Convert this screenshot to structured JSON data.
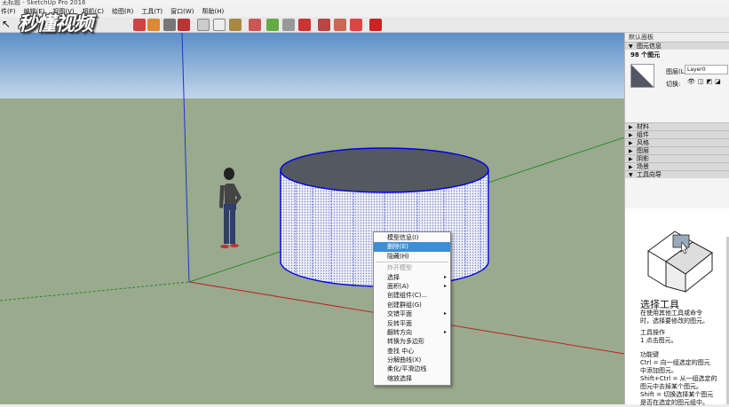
{
  "window": {
    "title": "无标题 - SketchUp Pro 2016"
  },
  "menu": [
    "件(F)",
    "编辑(E)",
    "视图(V)",
    "相机(C)",
    "绘图(R)",
    "工具(T)",
    "窗口(W)",
    "帮助(H)"
  ],
  "watermark": "秒懂视频",
  "context_menu": {
    "items": [
      {
        "label": "模型信息(I)",
        "state": "normal"
      },
      {
        "label": "删除(E)",
        "state": "highlight"
      },
      {
        "label": "隐藏(H)",
        "state": "normal"
      },
      {
        "label": "炸开模型",
        "state": "disabled"
      },
      {
        "label": "选择",
        "state": "submenu"
      },
      {
        "label": "面积(A)",
        "state": "submenu"
      },
      {
        "label": "创建组件(C)...",
        "state": "normal"
      },
      {
        "label": "创建群组(G)",
        "state": "normal"
      },
      {
        "label": "交错平面",
        "state": "submenu"
      },
      {
        "label": "反转平面",
        "state": "normal"
      },
      {
        "label": "翻转方向",
        "state": "submenu"
      },
      {
        "label": "转换为多边形",
        "state": "normal"
      },
      {
        "label": "查找 中心",
        "state": "normal"
      },
      {
        "label": "分解曲线(X)",
        "state": "normal"
      },
      {
        "label": "柔化/平滑边线",
        "state": "normal"
      },
      {
        "label": "缩放选择",
        "state": "normal"
      }
    ]
  },
  "panel": {
    "title": "默认面板",
    "entity_info": {
      "header": "图元信息",
      "count": "98 个图元",
      "layer_label": "图层(L):",
      "layer_value": "Layer0",
      "toggle_label": "切换:"
    },
    "sections": [
      "材料",
      "组件",
      "风格",
      "图层",
      "阴影",
      "场景",
      "工具向导"
    ],
    "guide": {
      "title": "选择工具",
      "desc": "在使用其他工具或命令\n时，选择要修改的图元。",
      "op_title": "工具操作",
      "op_text": "1 点击图元。",
      "key_title": "功能键",
      "key_text": "Ctrl = 向一组选定的图元\n中添加图元。\nShift+Ctrl = 从一组选定的\n图元中去掉某个图元。\nShift = 切换选择某个图元\n是否在选定的图元组中。"
    }
  },
  "colors": {
    "sky": "#a9c6e4",
    "ground": "#9aaa8f",
    "selection": "#0000e0",
    "highlight": "#3b8fd6"
  }
}
